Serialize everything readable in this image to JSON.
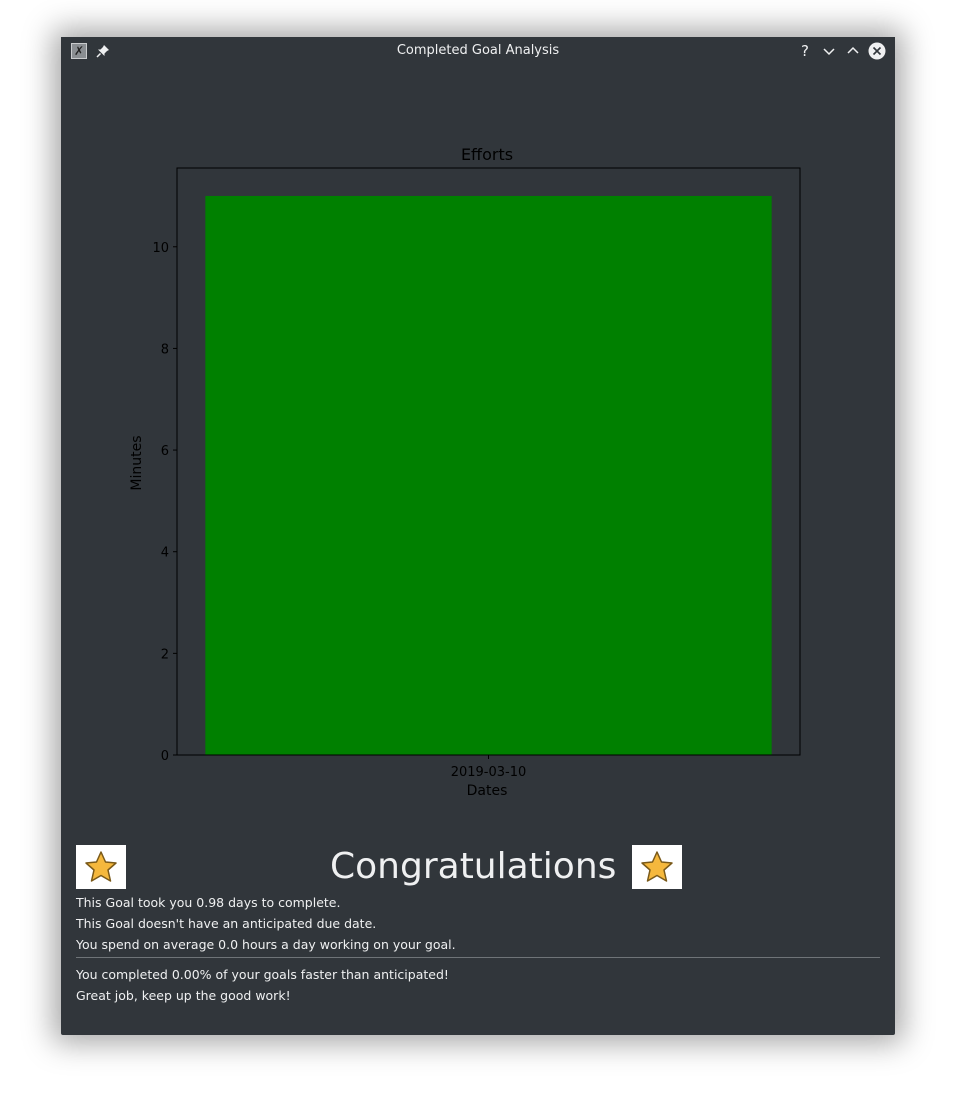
{
  "window": {
    "title": "Completed Goal Analysis",
    "help_label": "?"
  },
  "chart_data": {
    "type": "bar",
    "title": "Efforts",
    "xlabel": "Dates",
    "ylabel": "Minutes",
    "categories": [
      "2019-03-10"
    ],
    "values": [
      11
    ],
    "ylim": [
      0,
      11.55
    ],
    "yticks": [
      0,
      2,
      4,
      6,
      8,
      10
    ],
    "bar_color": "#008000",
    "grid": false
  },
  "summary": {
    "congrats": "Congratulations",
    "lines": [
      "This Goal took you 0.98 days to complete.",
      "This Goal doesn't have an anticipated due date.",
      "You spend on average 0.0 hours a day working on your goal."
    ],
    "lines2": [
      "You completed 0.00% of your goals faster than anticipated!",
      "Great job, keep up the good work!"
    ]
  },
  "colors": {
    "window_bg": "#31363b",
    "text": "#eff0f1",
    "star": "#f5b83d"
  }
}
